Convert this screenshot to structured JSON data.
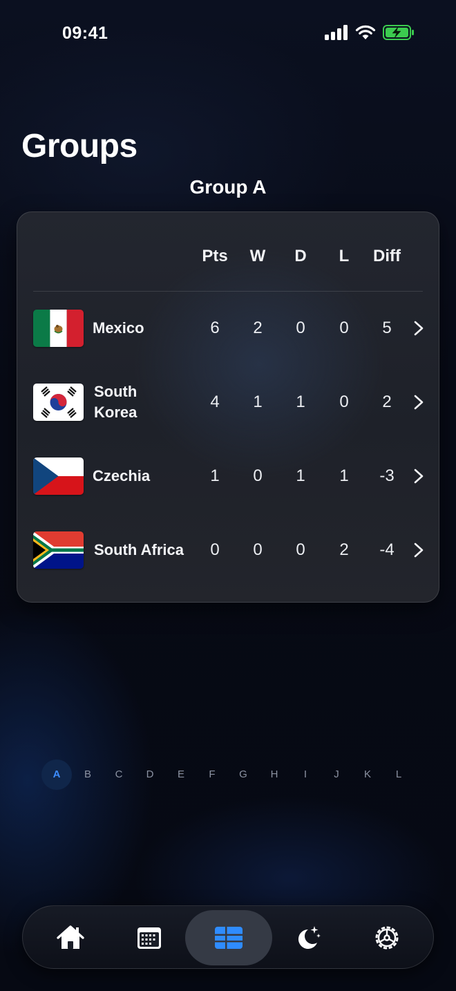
{
  "status": {
    "time": "09:41"
  },
  "page": {
    "title": "Groups"
  },
  "group": {
    "title": "Group A",
    "columns": [
      "Pts",
      "W",
      "D",
      "L",
      "Diff"
    ],
    "rows": [
      {
        "team": "Mexico",
        "flag": "mexico-flag-icon",
        "pts": "6",
        "w": "2",
        "d": "0",
        "l": "0",
        "diff": "5"
      },
      {
        "team": "South Korea",
        "flag": "south-korea-flag-icon",
        "pts": "4",
        "w": "1",
        "d": "1",
        "l": "0",
        "diff": "2"
      },
      {
        "team": "Czechia",
        "flag": "czechia-flag-icon",
        "pts": "1",
        "w": "0",
        "d": "1",
        "l": "1",
        "diff": "-3"
      },
      {
        "team": "South Africa",
        "flag": "south-africa-flag-icon",
        "pts": "0",
        "w": "0",
        "d": "0",
        "l": "2",
        "diff": "-4"
      }
    ]
  },
  "letters": {
    "items": [
      "A",
      "B",
      "C",
      "D",
      "E",
      "F",
      "G",
      "H",
      "I",
      "J",
      "K",
      "L"
    ],
    "selected": "A"
  },
  "tabbar": {
    "items": [
      {
        "icon": "home-icon"
      },
      {
        "icon": "calendar-icon"
      },
      {
        "icon": "table-icon",
        "active": true
      },
      {
        "icon": "moon-stars-icon"
      },
      {
        "icon": "settings-icon"
      }
    ]
  },
  "colors": {
    "accent": "#2f8cff",
    "battery": "#3ccb4f",
    "background": "#070a14"
  }
}
